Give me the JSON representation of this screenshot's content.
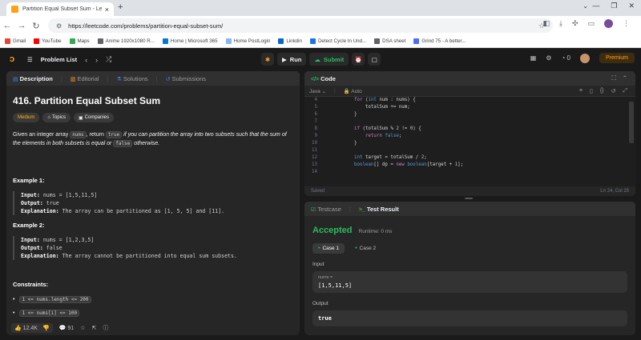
{
  "browser": {
    "tab_title": "Partition Equal Subset Sum - Le",
    "url": "https://leetcode.com/problems/partition-equal-subset-sum/",
    "bookmarks": [
      {
        "label": "Gmail",
        "color": "#ea4335"
      },
      {
        "label": "YouTube",
        "color": "#ff0000"
      },
      {
        "label": "Maps",
        "color": "#34a853"
      },
      {
        "label": "Anime 1920x1080 R...",
        "color": "#5f6368"
      },
      {
        "label": "Home | Microsoft 365",
        "color": "#0078d4"
      },
      {
        "label": "Home PostLogin",
        "color": "#8ab4f8"
      },
      {
        "label": "Linkdin",
        "color": "#0a66c2"
      },
      {
        "label": "Detect Cycle In Und...",
        "color": "#1a73e8"
      },
      {
        "label": "DSA sheet",
        "color": "#5f6368"
      },
      {
        "label": "Grind 75 - A better...",
        "color": "#4c6ef5"
      }
    ]
  },
  "nav": {
    "problem_list": "Problem List",
    "run": "Run",
    "submit": "Submit",
    "coins": "0",
    "premium": "Premium"
  },
  "description_panel": {
    "tabs": [
      "Description",
      "Editorial",
      "Solutions",
      "Submissions"
    ],
    "title": "416. Partition Equal Subset Sum",
    "badges": [
      "Medium",
      "Topics",
      "Companies"
    ],
    "statement": {
      "p1": "Given an integer array ",
      "code1": "nums",
      "p2": ", return ",
      "code2": "true",
      "p3": " if you can partition the array into two subsets such that the sum of the elements in both subsets is equal or ",
      "code3": "false",
      "p4": " otherwise."
    },
    "examples": [
      {
        "title": "Example 1:",
        "input_label": "Input:",
        "input": "nums = [1,5,11,5]",
        "output_label": "Output:",
        "output": "true",
        "explanation_label": "Explanation:",
        "explanation": "The array can be partitioned as [1, 5, 5] and [11]."
      },
      {
        "title": "Example 2:",
        "input_label": "Input:",
        "input": "nums = [1,2,3,5]",
        "output_label": "Output:",
        "output": "false",
        "explanation_label": "Explanation:",
        "explanation": "The array cannot be partitioned into equal sum subsets."
      }
    ],
    "constraints_title": "Constraints:",
    "constraints": [
      "1 <= nums.length <= 200",
      "1 <= nums[i] <= 100"
    ],
    "footer": {
      "likes": "12.4K",
      "comments": "91"
    }
  },
  "code_panel": {
    "title": "Code",
    "language": "Java",
    "mode": "Auto",
    "status_left": "Saved",
    "status_right": "Ln 24, Col 25",
    "lines": [
      {
        "n": "4",
        "text": "    for (int num : nums) {"
      },
      {
        "n": "5",
        "text": "        totalSum += num;"
      },
      {
        "n": "6",
        "text": "    }"
      },
      {
        "n": "7",
        "text": ""
      },
      {
        "n": "8",
        "text": "    if (totalSum % 2 != 0) {"
      },
      {
        "n": "9",
        "text": "        return false;"
      },
      {
        "n": "10",
        "text": "    }"
      },
      {
        "n": "11",
        "text": ""
      },
      {
        "n": "12",
        "text": "    int target = totalSum / 2;"
      },
      {
        "n": "13",
        "text": "    boolean[] dp = new boolean[target + 1];"
      },
      {
        "n": "14",
        "text": ""
      }
    ]
  },
  "test_panel": {
    "tabs": [
      "Testcase",
      "Test Result"
    ],
    "verdict": "Accepted",
    "runtime": "Runtime: 0 ms",
    "cases": [
      "Case 1",
      "Case 2"
    ],
    "input_label": "Input",
    "input_var": "nums =",
    "input_value": "[1,5,11,5]",
    "output_label": "Output",
    "output_value": "true"
  }
}
